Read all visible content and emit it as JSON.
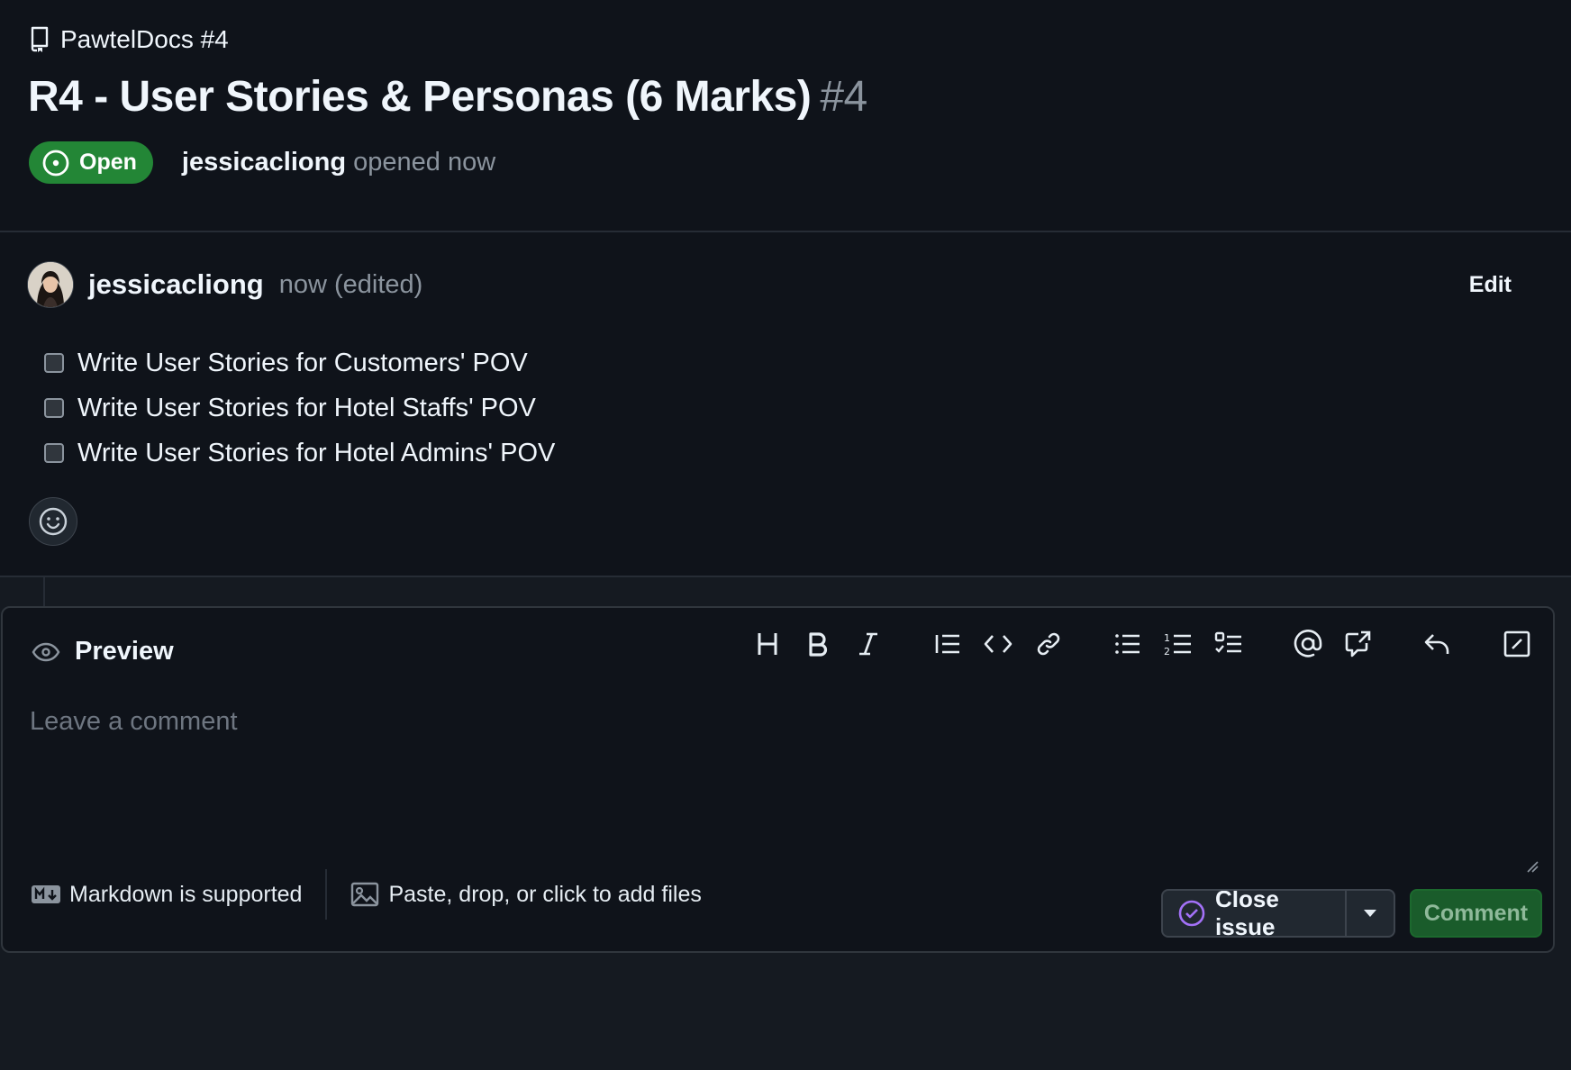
{
  "repo": {
    "name": "PawtelDocs #4",
    "icon": "repo-icon"
  },
  "issue": {
    "title": "R4 - User Stories & Personas (6 Marks)",
    "number": "#4",
    "state": "Open",
    "author": "jessicacliong",
    "opened_text": "opened now"
  },
  "comment": {
    "author": "jessicacliong",
    "meta": "now (edited)",
    "edit_label": "Edit",
    "tasks": [
      "Write User Stories for Customers' POV",
      "Write User Stories for Hotel Staffs' POV",
      "Write User Stories for Hotel Admins' POV"
    ]
  },
  "editor": {
    "preview_label": "Preview",
    "placeholder": "Leave a comment",
    "markdown_note": "Markdown is supported",
    "files_note": "Paste, drop, or click to add files",
    "close_label": "Close issue",
    "comment_label": "Comment",
    "toolbar": [
      "heading-icon",
      "bold-icon",
      "italic-icon",
      "quote-icon",
      "code-icon",
      "link-icon",
      "bulleted-list-icon",
      "numbered-list-icon",
      "task-list-icon",
      "mention-icon",
      "cross-reference-icon",
      "saved-replies-icon",
      "slash-command-icon"
    ]
  },
  "colors": {
    "open_green": "#238636",
    "close_purple": "#a371f7",
    "background": "#0f131a"
  }
}
